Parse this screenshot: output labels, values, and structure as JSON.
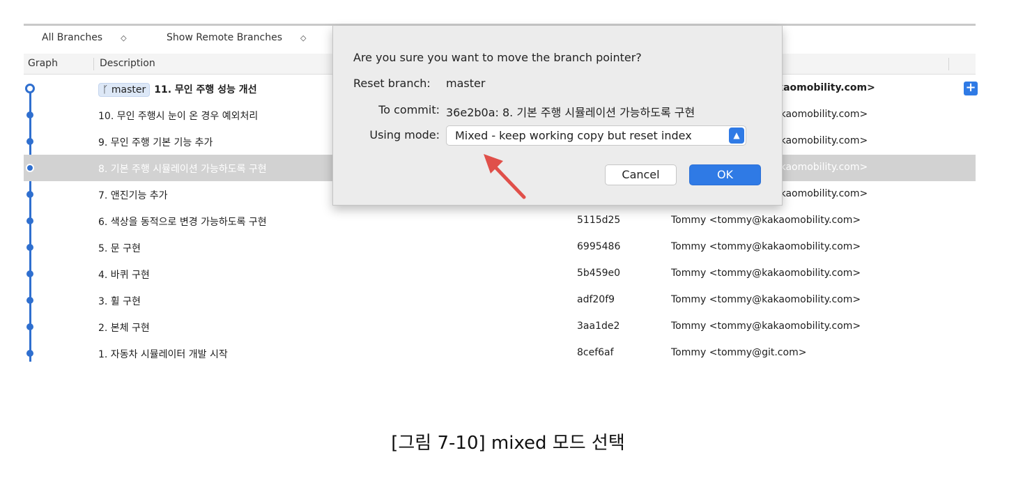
{
  "toolbar": {
    "all_branches": "All Branches",
    "show_remote": "Show Remote Branches"
  },
  "columns": {
    "graph": "Graph",
    "description": "Description"
  },
  "head_branch": "master",
  "commits": [
    {
      "description": "11. 무인 주행 성능 개선",
      "hash": "",
      "author": "kakaomobility.com>"
    },
    {
      "description": "10. 무인 주행시 눈이 온 경우 예외처리",
      "hash": "",
      "author": "akaomobility.com>"
    },
    {
      "description": "9. 무인 주행 기본 기능 추가",
      "hash": "",
      "author": "akaomobility.com>"
    },
    {
      "description": "8. 기본 주행 시뮬레이션 가능하도록 구현",
      "hash": "",
      "author": "akaomobility.com>"
    },
    {
      "description": "7. 앤진기능 추가",
      "hash": "",
      "author": "akaomobility.com>"
    },
    {
      "description": "6. 색상을 동적으로 변경 가능하도록 구현",
      "hash": "5115d25",
      "author": "Tommy <tommy@kakaomobility.com>"
    },
    {
      "description": "5. 문 구현",
      "hash": "6995486",
      "author": "Tommy <tommy@kakaomobility.com>"
    },
    {
      "description": "4. 바퀴 구현",
      "hash": "5b459e0",
      "author": "Tommy <tommy@kakaomobility.com>"
    },
    {
      "description": "3. 휠 구현",
      "hash": "adf20f9",
      "author": "Tommy <tommy@kakaomobility.com>"
    },
    {
      "description": "2. 본체 구현",
      "hash": "3aa1de2",
      "author": "Tommy <tommy@kakaomobility.com>"
    },
    {
      "description": "1. 자동차 시뮬레이터 개발 시작",
      "hash": "8cef6af",
      "author": "Tommy <tommy@git.com>"
    }
  ],
  "dialog": {
    "question": "Are you sure you want to move the branch pointer?",
    "reset_branch_label": "Reset branch:",
    "reset_branch_value": "master",
    "to_commit_label": "To commit:",
    "to_commit_value": "36e2b0a: 8. 기본 주행 시뮬레이션 가능하도록 구현",
    "mode_label": "Using mode:",
    "mode_value": "Mixed - keep working copy but reset index",
    "cancel": "Cancel",
    "ok": "OK"
  },
  "caption": "[그림 7-10] mixed 모드 선택",
  "colors": {
    "accent": "#2f7ae5",
    "graph": "#2f6fcf",
    "selection": "#d2d2d2",
    "arrow": "#e0504a"
  }
}
